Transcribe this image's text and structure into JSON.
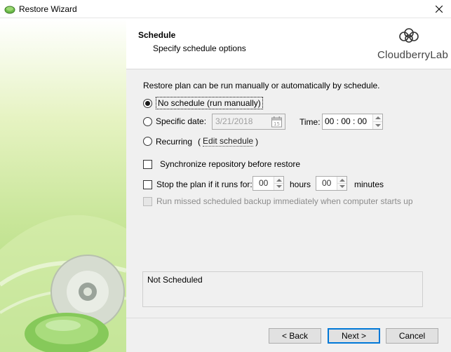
{
  "window": {
    "title": "Restore Wizard"
  },
  "header": {
    "title": "Schedule",
    "subtitle": "Specify schedule options",
    "brand": "CloudberryLab"
  },
  "intro": "Restore plan can be run manually or automatically by schedule.",
  "options": {
    "no_schedule": {
      "label": "No schedule (run manually)",
      "checked": true
    },
    "specific_date": {
      "label": "Specific date:",
      "date_value": "3/21/2018",
      "checked": false
    },
    "time": {
      "label": "Time:",
      "value": "00 : 00 : 00"
    },
    "recurring": {
      "label": "Recurring",
      "link": "Edit schedule",
      "checked": false
    }
  },
  "checkboxes": {
    "sync_repo": {
      "label": "Synchronize repository before restore",
      "checked": false
    },
    "stop_plan": {
      "label": "Stop the plan if it runs for:",
      "hours_value": "00",
      "hours_label": "hours",
      "minutes_value": "00",
      "minutes_label": "minutes",
      "checked": false
    },
    "run_missed": {
      "label": "Run missed scheduled backup immediately when computer starts up",
      "checked": false,
      "enabled": false
    }
  },
  "status": "Not Scheduled",
  "buttons": {
    "back": "< Back",
    "next": "Next >",
    "cancel": "Cancel"
  },
  "colors": {
    "accent": "#0078d7",
    "side_green": "#a8d975"
  }
}
